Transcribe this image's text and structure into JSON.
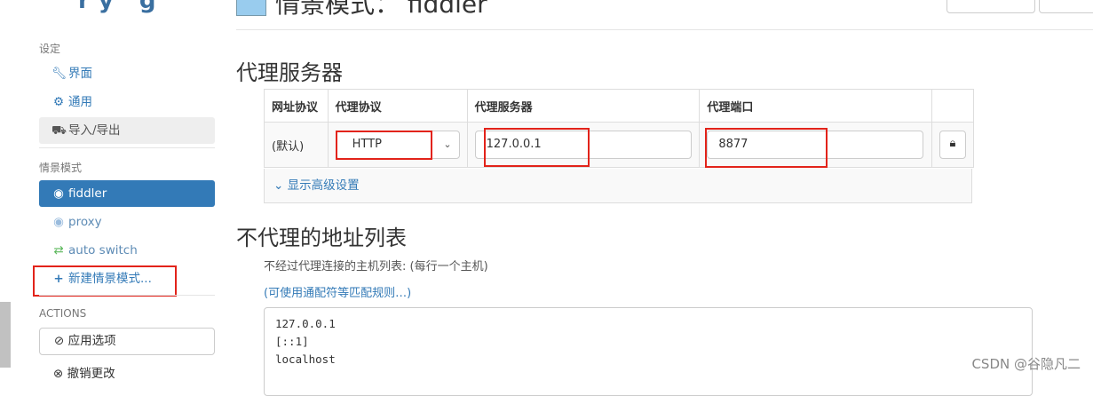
{
  "sidebar": {
    "header_fragment": "ry g",
    "settings_heading": "设定",
    "settings_items": [
      {
        "label": "界面",
        "icon": "wrench-icon"
      },
      {
        "label": "通用",
        "icon": "gear-icon"
      },
      {
        "label": "导入/导出",
        "icon": "flowchart-icon"
      }
    ],
    "profiles_heading": "情景模式",
    "profiles": [
      {
        "label": "fiddler",
        "icon": "globe-icon"
      },
      {
        "label": "proxy",
        "icon": "globe-icon"
      },
      {
        "label": "auto switch",
        "icon": "switch-icon"
      }
    ],
    "new_profile": "新建情景模式...",
    "actions_heading": "ACTIONS",
    "apply_options": "应用选项",
    "discard_changes": "撤销更改"
  },
  "main": {
    "title_fragment": "情景模式： fiddler",
    "proxy_heading": "代理服务器",
    "table_headers": [
      "网址协议",
      "代理协议",
      "代理服务器",
      "代理端口"
    ],
    "row": {
      "scheme": "(默认)",
      "protocol": "HTTP",
      "server": "127.0.0.1",
      "port": "8877"
    },
    "advanced_link": "显示高级设置",
    "bypass_heading": "不代理的地址列表",
    "bypass_help": "不经过代理连接的主机列表: (每行一个主机)",
    "bypass_wildcard_link": "(可使用通配符等匹配规则…)",
    "bypass_list": [
      "127.0.0.1",
      "[::1]",
      "localhost"
    ]
  },
  "watermark": "CSDN @谷隐凡二",
  "colors": {
    "accent": "#337ab7",
    "highlight_box": "#e2231a"
  }
}
